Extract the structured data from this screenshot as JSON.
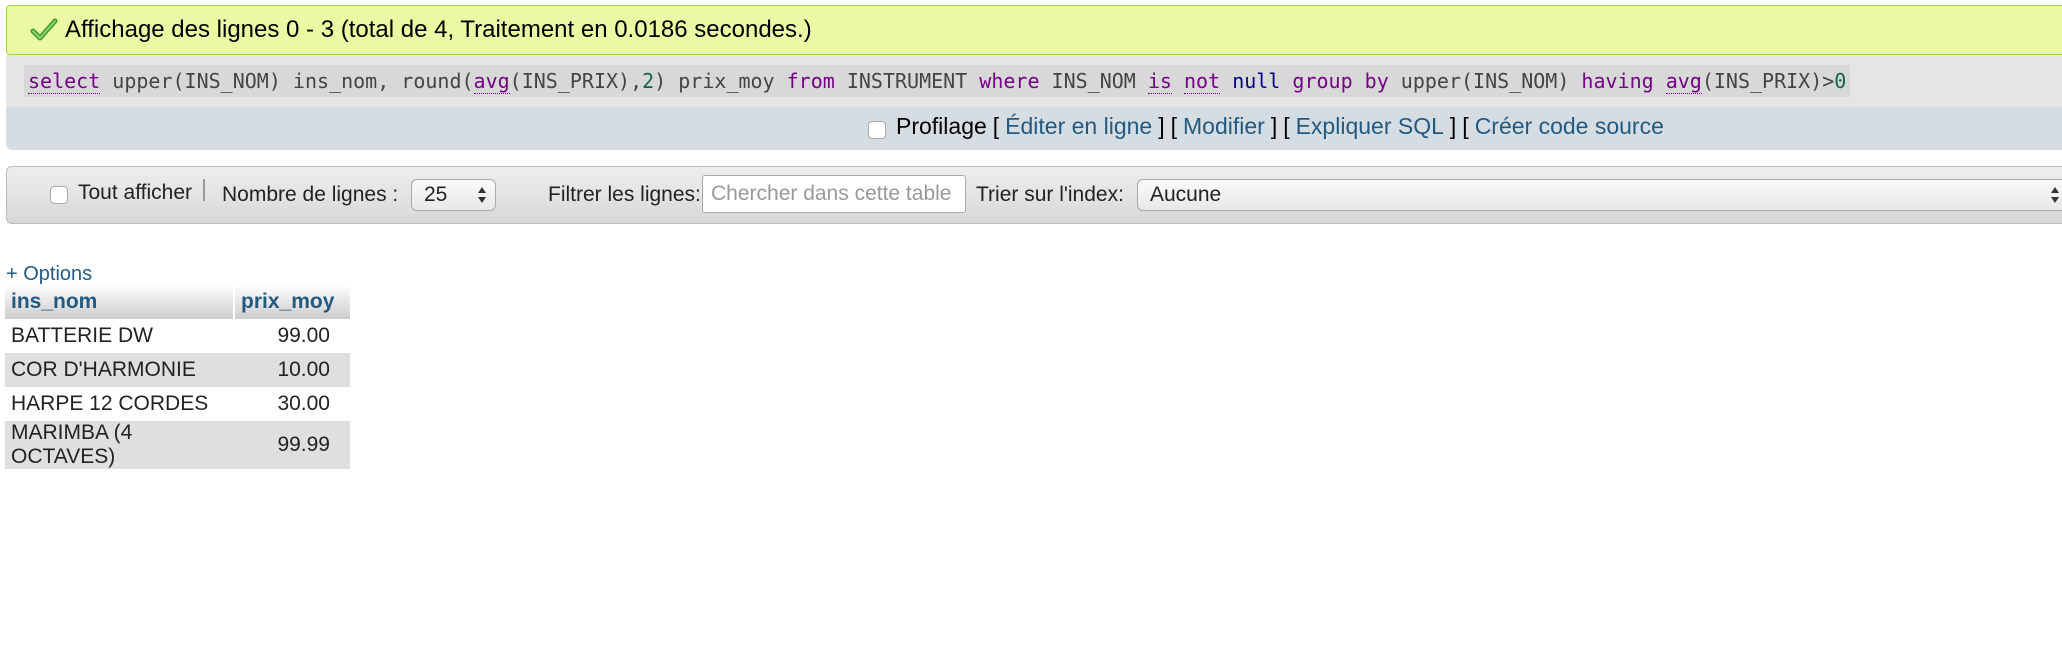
{
  "banner": {
    "message": "Affichage des lignes 0 - 3 (total de 4, Traitement en 0.0186 secondes.)",
    "icon": "checkmark-icon"
  },
  "sql_query": {
    "t1": "select",
    "t2": " upper(INS_NOM) ins_nom, round(",
    "t3": "avg",
    "t4": "(INS_PRIX),",
    "t5": "2",
    "t6": ") prix_moy ",
    "t7": "from",
    "t8": " INSTRUMENT ",
    "t9": "where",
    "t10": " INS_NOM ",
    "t11": "is",
    "t12": " ",
    "t13": "not",
    "t14": " ",
    "t15": "null",
    "t16": " ",
    "t17": "group",
    "t18": " ",
    "t19": "by",
    "t20": " upper(INS_NOM) ",
    "t21": "having",
    "t22": " ",
    "t23": "avg",
    "t24": "(INS_PRIX)>",
    "t25": "0"
  },
  "actions": {
    "profiling_label": "Profilage",
    "bracket_open": "[",
    "bracket_close": "]",
    "edit_inline": "Éditer en ligne",
    "modify": "Modifier",
    "explain_sql": "Expliquer SQL",
    "create_source": "Créer code source"
  },
  "navigation": {
    "show_all_label": "Tout afficher",
    "rows_label": "Nombre de lignes :",
    "rows_value": "25",
    "filter_label": "Filtrer les lignes:",
    "filter_placeholder": "Chercher dans cette table",
    "sort_label": "Trier sur l'index:",
    "sort_value": "Aucune"
  },
  "options_link": "+ Options",
  "table": {
    "headers": [
      "ins_nom",
      "prix_moy"
    ],
    "rows": [
      [
        "BATTERIE DW",
        "99.00"
      ],
      [
        "COR D'HARMONIE",
        "10.00"
      ],
      [
        "HARPE 12 CORDES",
        "30.00"
      ],
      [
        "MARIMBA (4 OCTAVES)",
        "99.99"
      ]
    ]
  },
  "colors": {
    "success_bg": "#ebf8a4",
    "link": "#235a81",
    "keyword": "#770088"
  }
}
